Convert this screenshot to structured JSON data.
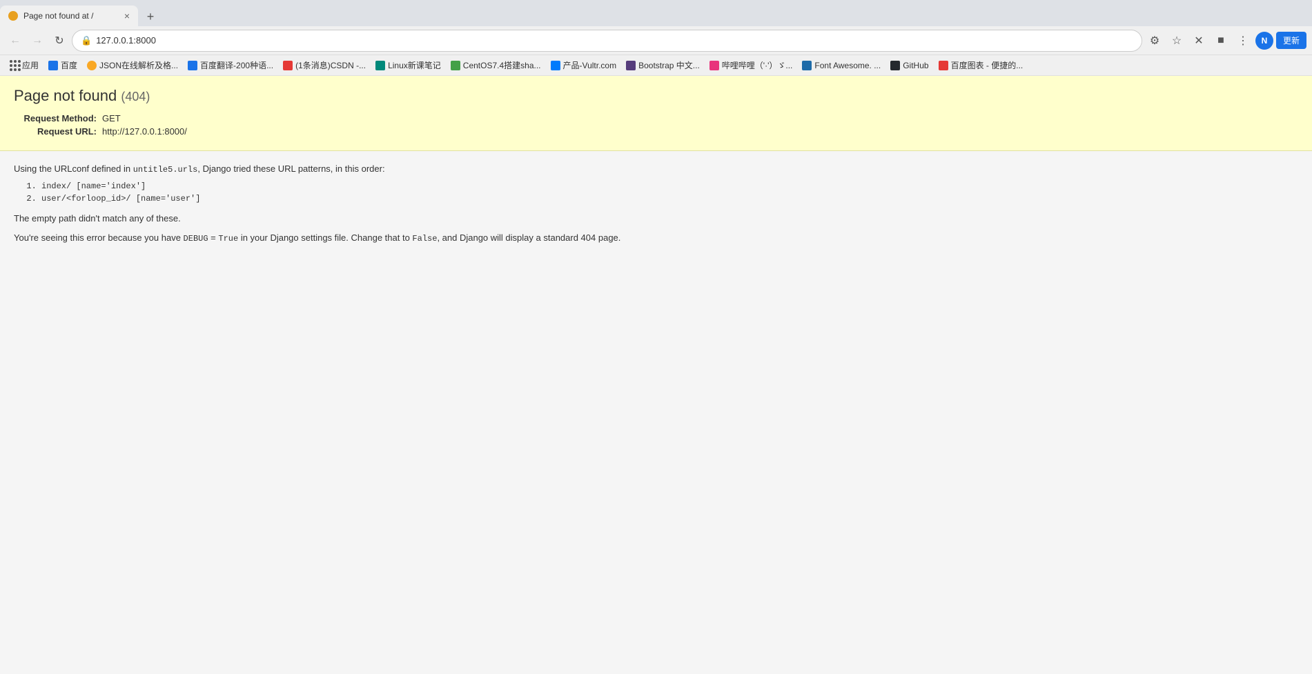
{
  "browser": {
    "tab": {
      "title": "Page not found at /",
      "icon_color": "#e8a020"
    },
    "address": "127.0.0.1:8000",
    "new_tab_label": "+",
    "close_tab_label": "×"
  },
  "nav": {
    "back_label": "←",
    "forward_label": "→",
    "refresh_label": "↻",
    "user_initial": "N",
    "update_label": "更新"
  },
  "bookmarks": [
    {
      "id": "apps",
      "label": "应用",
      "color": ""
    },
    {
      "id": "baidu",
      "label": "百度",
      "color": "bk-blue"
    },
    {
      "id": "json",
      "label": "JSON在线解析及格...",
      "color": "bk-yellow"
    },
    {
      "id": "fanyi",
      "label": "百度翻译-200种语...",
      "color": "bk-blue"
    },
    {
      "id": "csdn",
      "label": "(1条消息)CSDN -...",
      "color": "bk-red"
    },
    {
      "id": "linux",
      "label": "Linux新课笔记",
      "color": "bk-teal"
    },
    {
      "id": "centos",
      "label": "CentOS7.4搭建sha...",
      "color": "bk-green"
    },
    {
      "id": "vultr",
      "label": "产品-Vultr.com",
      "color": "bk-navy"
    },
    {
      "id": "bootstrap",
      "label": "Bootstrap 中文...",
      "color": "bk-dark"
    },
    {
      "id": "biji",
      "label": "哔哩哔哩（'·'）ゞ...",
      "color": "bk-orange"
    },
    {
      "id": "fontawesome",
      "label": "Font Awesome...",
      "color": "bk-darkblue"
    },
    {
      "id": "github",
      "label": "GitHub",
      "color": "bk-dark"
    },
    {
      "id": "baidumap",
      "label": "百度图表 - 便捷的...",
      "color": "bk-red"
    }
  ],
  "page": {
    "title": "Page not found",
    "status_code": "(404)",
    "request_method_label": "Request Method:",
    "request_method_value": "GET",
    "request_url_label": "Request URL:",
    "request_url_value": "http://127.0.0.1:8000/",
    "urlconf_intro": "Using the URLconf defined in ",
    "urlconf_name": "untitle5.urls",
    "urlconf_mid": ", Django tried these URL patterns, in this order:",
    "url_patterns": [
      "index/  [name='index']",
      "user/<forloop_id>/  [name='user']"
    ],
    "empty_path_message": "The empty path didn't match any of these.",
    "debug_note_pre": "You're seeing this error because you have ",
    "debug_setting": "DEBUG",
    "debug_eq": " = ",
    "debug_value": "True",
    "debug_mid": " in your Django settings file. Change that to ",
    "debug_false": "False",
    "debug_post": ", and Django will display a standard 404 page."
  }
}
